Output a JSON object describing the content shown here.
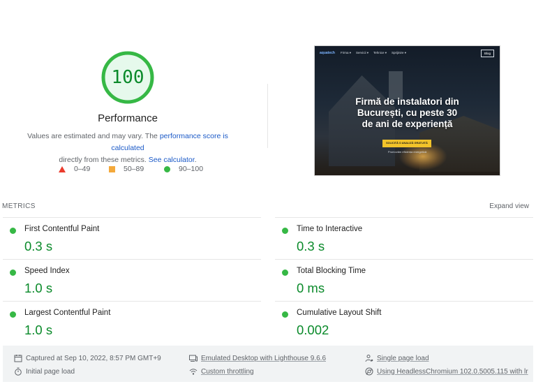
{
  "score": {
    "value": "100",
    "fraction": 1.0,
    "title": "Performance",
    "color": "#0cce6b"
  },
  "description": {
    "prefix": "Values are estimated and may vary. The ",
    "link1": "performance score is calculated",
    "middle": " directly from these metrics. ",
    "link2": "See calculator",
    "suffix": "."
  },
  "legend": [
    {
      "shape": "triangle",
      "label": "0–49",
      "color": "#eb3b2c"
    },
    {
      "shape": "square",
      "label": "50–89",
      "color": "#f4a93b"
    },
    {
      "shape": "circle",
      "label": "90–100",
      "color": "#36b845"
    }
  ],
  "thumbnail": {
    "logo": "aquatech",
    "menu": [
      "Firma ▾",
      "Servicii ▾",
      "Tehnice ▾",
      "Sprijinire ▾"
    ],
    "button": "Blog",
    "headline_lines": [
      "Firmă de instalatori din",
      "București, cu peste 30",
      "de ani de experiență"
    ],
    "cta": "SOLICITĂ O ANALIZĂ GRATUITĂ",
    "sub": "Promovăm eficiența energetică"
  },
  "metrics": {
    "header": "METRICS",
    "expand": "Expand view",
    "items": [
      {
        "label": "First Contentful Paint",
        "value": "0.3 s",
        "status_color": "#36b845"
      },
      {
        "label": "Time to Interactive",
        "value": "0.3 s",
        "status_color": "#36b845"
      },
      {
        "label": "Speed Index",
        "value": "1.0 s",
        "status_color": "#36b845"
      },
      {
        "label": "Total Blocking Time",
        "value": "0 ms",
        "status_color": "#36b845"
      },
      {
        "label": "Largest Contentful Paint",
        "value": "1.0 s",
        "status_color": "#36b845"
      },
      {
        "label": "Cumulative Layout Shift",
        "value": "0.002",
        "status_color": "#36b845"
      }
    ]
  },
  "footer": {
    "captured": "Captured at Sep 10, 2022, 8:57 PM GMT+9",
    "emulated": "Emulated Desktop with Lighthouse 9.6.6",
    "single_page": "Single page load",
    "initial_load": "Initial page load",
    "throttling": "Custom throttling",
    "browser": "Using HeadlessChromium 102.0.5005.115 with lr"
  }
}
